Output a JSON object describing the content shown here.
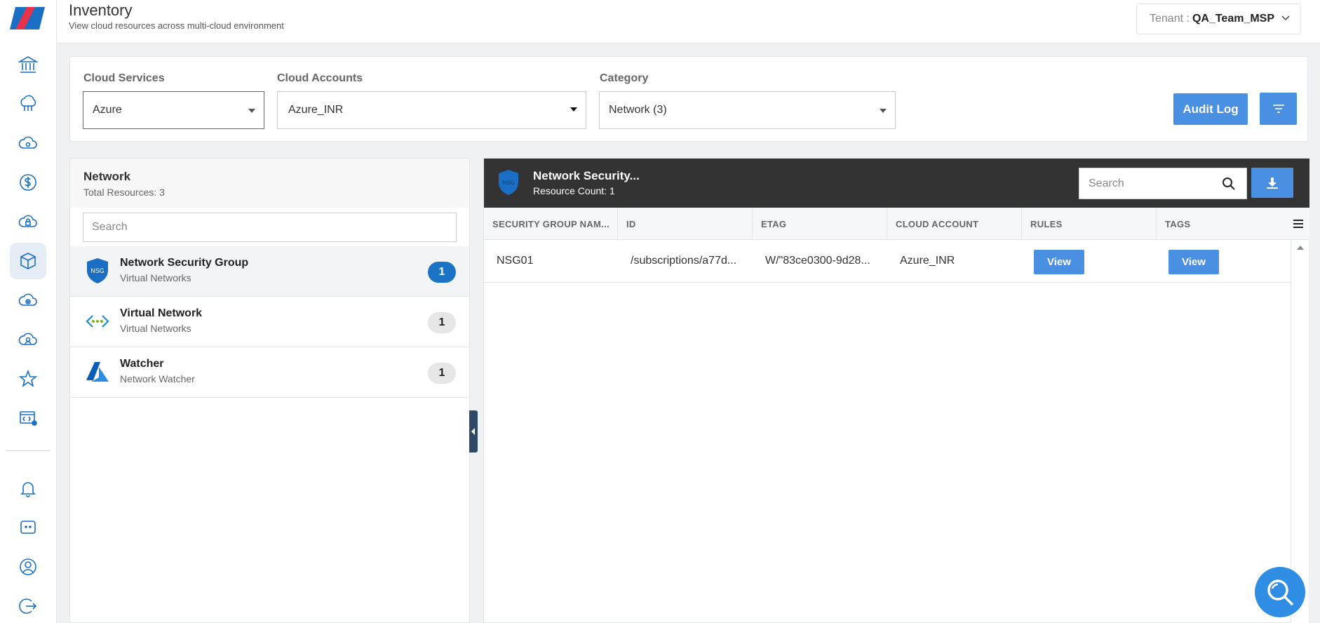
{
  "header": {
    "title": "Inventory",
    "subtitle": "View cloud resources across multi-cloud environment",
    "tenant_label": "Tenant :",
    "tenant_value": "QA_Team_MSP"
  },
  "sidebar": {
    "items": [
      {
        "icon": "bank-icon"
      },
      {
        "icon": "cloud-network-icon"
      },
      {
        "icon": "cloud-icon"
      },
      {
        "icon": "dollar-icon"
      },
      {
        "icon": "cloud-lock-icon"
      },
      {
        "icon": "cube-icon",
        "active": true
      },
      {
        "icon": "cloud-gear-icon"
      },
      {
        "icon": "cloud-user-icon"
      },
      {
        "icon": "star-icon"
      },
      {
        "icon": "code-settings-icon"
      },
      {
        "icon": "bell-icon"
      },
      {
        "icon": "chat-icon"
      },
      {
        "icon": "user-circle-icon"
      },
      {
        "icon": "logout-icon"
      }
    ]
  },
  "filters": {
    "cloud_services": {
      "label": "Cloud Services",
      "value": "Azure"
    },
    "cloud_accounts": {
      "label": "Cloud Accounts",
      "value": "Azure_INR"
    },
    "category": {
      "label": "Category",
      "value": "Network (3)"
    },
    "audit_log_label": "Audit Log"
  },
  "left_panel": {
    "title": "Network",
    "subtitle": "Total Resources: 3",
    "search_placeholder": "Search",
    "items": [
      {
        "name": "Network Security Group",
        "category": "Virtual Networks",
        "count": "1",
        "icon": "nsg-shield-icon",
        "active": true
      },
      {
        "name": "Virtual Network",
        "category": "Virtual Networks",
        "count": "1",
        "icon": "vnet-icon"
      },
      {
        "name": "Watcher",
        "category": "Network Watcher",
        "count": "1",
        "icon": "azure-logo-icon"
      }
    ]
  },
  "right_panel": {
    "title": "Network Security...",
    "subtitle": "Resource Count: 1",
    "search_placeholder": "Search",
    "icon_text": "NSG",
    "columns": [
      "SECURITY GROUP NAM...",
      "ID",
      "ETAG",
      "CLOUD ACCOUNT",
      "RULES",
      "TAGS"
    ],
    "rows": [
      {
        "name": "NSG01",
        "id": "/subscriptions/a77d...",
        "etag": "W/\"83ce0300-9d28...",
        "account": "Azure_INR",
        "rules": "View",
        "tags": "View"
      }
    ]
  },
  "colors": {
    "accent": "#4a90e2",
    "active_badge": "#1a73c4",
    "dark_header": "#333333",
    "nav_icon": "#1a6fc4"
  }
}
